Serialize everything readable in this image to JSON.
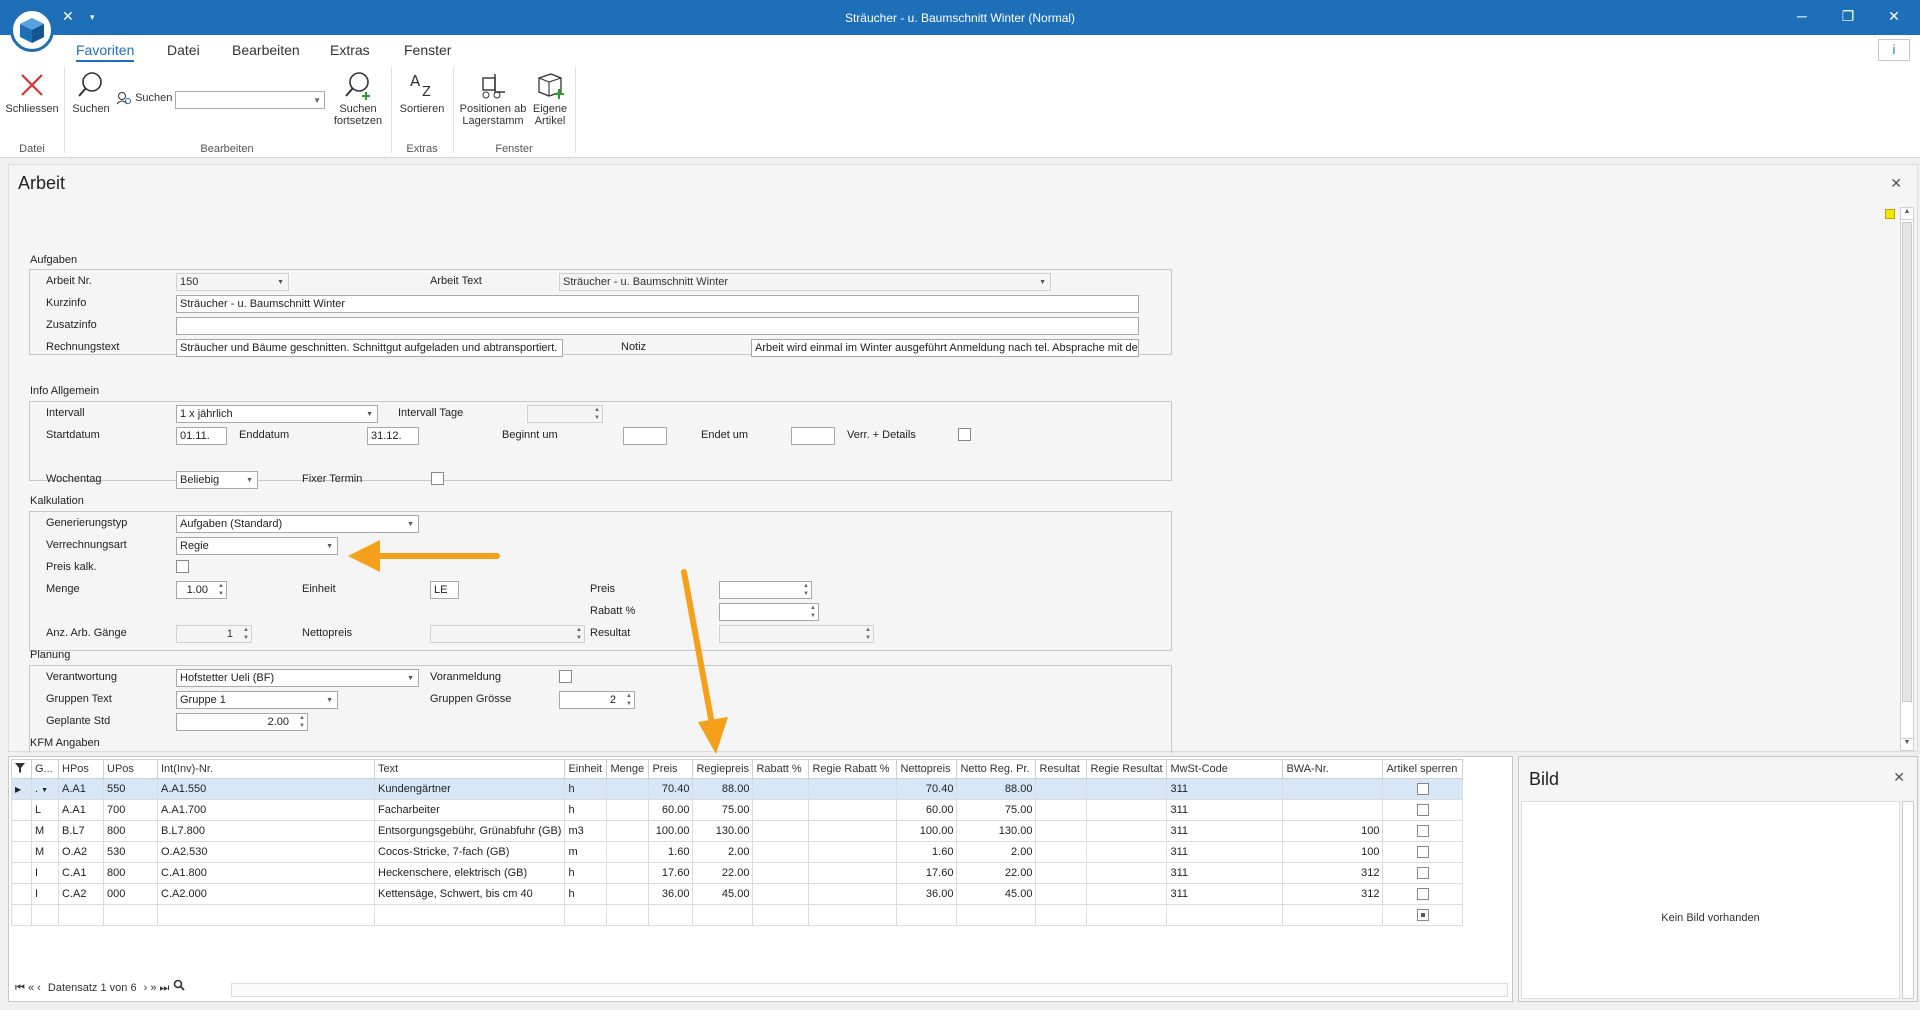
{
  "window": {
    "title": "Sträucher - u. Baumschnitt Winter (Normal)",
    "controls": [
      "─",
      "❐",
      "✕"
    ]
  },
  "menu": {
    "items": [
      "Favoriten",
      "Datei",
      "Bearbeiten",
      "Extras",
      "Fenster"
    ],
    "active": "Favoriten",
    "info": "i"
  },
  "ribbon": {
    "close": "Schliessen",
    "search": "Suchen",
    "search_label": "Suchen",
    "search_next": "Suchen fortsetzen",
    "sort": "Sortieren",
    "positions": "Positionen ab Lagerstamm",
    "own_articles": "Eigene Artikel",
    "groups": {
      "datei": "Datei",
      "bearbeiten": "Bearbeiten",
      "extras": "Extras",
      "fenster": "Fenster"
    }
  },
  "doc": {
    "title": "Arbeit",
    "sections": {
      "aufgaben": "Aufgaben",
      "info": "Info Allgemein",
      "kalkulation": "Kalkulation",
      "planung": "Planung",
      "kfm": "KFM Angaben"
    },
    "aufgaben": {
      "arbeit_nr_label": "Arbeit Nr.",
      "arbeit_nr": "150",
      "arbeit_text_label": "Arbeit Text",
      "arbeit_text": "Sträucher - u. Baumschnitt Winter",
      "kurzinfo_label": "Kurzinfo",
      "kurzinfo": "Sträucher - u. Baumschnitt Winter",
      "zusatzinfo_label": "Zusatzinfo",
      "zusatzinfo": "",
      "rechnungstext_label": "Rechnungstext",
      "rechnungstext": "Sträucher und Bäume geschnitten. Schnittgut aufgeladen und abtransportiert.",
      "notiz_label": "Notiz",
      "notiz": "Arbeit wird einmal im Winter ausgeführt Anmeldung nach tel. Absprache mit den"
    },
    "info": {
      "intervall_label": "Intervall",
      "intervall": "1 x jährlich",
      "intervall_tage_label": "Intervall Tage",
      "intervall_tage": "",
      "startdatum_label": "Startdatum",
      "startdatum": "01.11.",
      "enddatum_label": "Enddatum",
      "enddatum": "31.12.",
      "beginnt_label": "Beginnt um",
      "beginnt": "",
      "endet_label": "Endet um",
      "endet": "",
      "verr_label": "Verr. + Details",
      "wochentag_label": "Wochentag",
      "wochentag": "Beliebig",
      "fixer_label": "Fixer Termin"
    },
    "kalk": {
      "gen_label": "Generierungstyp",
      "gen": "Aufgaben (Standard)",
      "verr_label": "Verrechnungsart",
      "verr": "Regie",
      "preis_kalk_label": "Preis kalk.",
      "menge_label": "Menge",
      "menge": "1.00",
      "einheit_label": "Einheit",
      "einheit": "LE",
      "preis_label": "Preis",
      "preis": "",
      "rabatt_label": "Rabatt %",
      "rabatt": "",
      "anz_label": "Anz. Arb. Gänge",
      "anz": "1",
      "netto_label": "Nettopreis",
      "netto": "",
      "resultat_label": "Resultat",
      "resultat": ""
    },
    "planung": {
      "verantw_label": "Verantwortung",
      "verantw": "Hofstetter Ueli (BF)",
      "voranm_label": "Voranmeldung",
      "gruppen_label": "Gruppen Text",
      "gruppen": "Gruppe 1",
      "gruppen_gr_label": "Gruppen Grösse",
      "gruppen_gr": "2",
      "geplant_label": "Geplante Std",
      "geplant": "2.00"
    }
  },
  "grid": {
    "columns": [
      "G...",
      "HPos",
      "UPos",
      "Int(Inv)-Nr.",
      "Text",
      "Einheit",
      "Menge",
      "Preis",
      "Regiepreis",
      "Rabatt %",
      "Regie Rabatt %",
      "Nettopreis",
      "Netto Reg. Pr.",
      "Resultat",
      "Regie Resultat",
      "MwSt-Code",
      "BWA-Nr.",
      "Artikel sperren"
    ],
    "rows": [
      {
        "g": ".",
        "hpos": "A.A1",
        "upos": "550",
        "nr": "A.A1.550",
        "text": "Kundengärtner",
        "einheit": "h",
        "menge": "",
        "preis": "70.40",
        "regiepreis": "88.00",
        "rabatt": "",
        "regie_rabatt": "",
        "netto": "70.40",
        "netto_reg": "88.00",
        "resultat": "",
        "regie_resultat": "",
        "mwst": "311",
        "bwa": ""
      },
      {
        "g": "L",
        "hpos": "A.A1",
        "upos": "700",
        "nr": "A.A1.700",
        "text": "Facharbeiter",
        "einheit": "h",
        "menge": "",
        "preis": "60.00",
        "regiepreis": "75.00",
        "rabatt": "",
        "regie_rabatt": "",
        "netto": "60.00",
        "netto_reg": "75.00",
        "resultat": "",
        "regie_resultat": "",
        "mwst": "311",
        "bwa": ""
      },
      {
        "g": "M",
        "hpos": "B.L7",
        "upos": "800",
        "nr": "B.L7.800",
        "text": "Entsorgungsgebühr, Grünabfuhr (GB)",
        "einheit": "m3",
        "menge": "",
        "preis": "100.00",
        "regiepreis": "130.00",
        "rabatt": "",
        "regie_rabatt": "",
        "netto": "100.00",
        "netto_reg": "130.00",
        "resultat": "",
        "regie_resultat": "",
        "mwst": "311",
        "bwa": "100"
      },
      {
        "g": "M",
        "hpos": "O.A2",
        "upos": "530",
        "nr": "O.A2.530",
        "text": "Cocos-Stricke, 7-fach (GB)",
        "einheit": "m",
        "menge": "",
        "preis": "1.60",
        "regiepreis": "2.00",
        "rabatt": "",
        "regie_rabatt": "",
        "netto": "1.60",
        "netto_reg": "2.00",
        "resultat": "",
        "regie_resultat": "",
        "mwst": "311",
        "bwa": "100"
      },
      {
        "g": "I",
        "hpos": "C.A1",
        "upos": "800",
        "nr": "C.A1.800",
        "text": "Heckenschere, elektrisch (GB)",
        "einheit": "h",
        "menge": "",
        "preis": "17.60",
        "regiepreis": "22.00",
        "rabatt": "",
        "regie_rabatt": "",
        "netto": "17.60",
        "netto_reg": "22.00",
        "resultat": "",
        "regie_resultat": "",
        "mwst": "311",
        "bwa": "312"
      },
      {
        "g": "I",
        "hpos": "C.A2",
        "upos": "000",
        "nr": "C.A2.000",
        "text": "Kettensäge, Schwert, bis cm 40",
        "einheit": "h",
        "menge": "",
        "preis": "36.00",
        "regiepreis": "45.00",
        "rabatt": "",
        "regie_rabatt": "",
        "netto": "36.00",
        "netto_reg": "45.00",
        "resultat": "",
        "regie_resultat": "",
        "mwst": "311",
        "bwa": "312"
      }
    ],
    "navigator": "Datensatz 1 von 6"
  },
  "bild": {
    "title": "Bild",
    "empty": "Kein Bild vorhanden"
  },
  "colors": {
    "titlebar": "#1d6fb8",
    "selected_row": "#d7e7f7",
    "annotation_arrow": "#f5a01a"
  }
}
